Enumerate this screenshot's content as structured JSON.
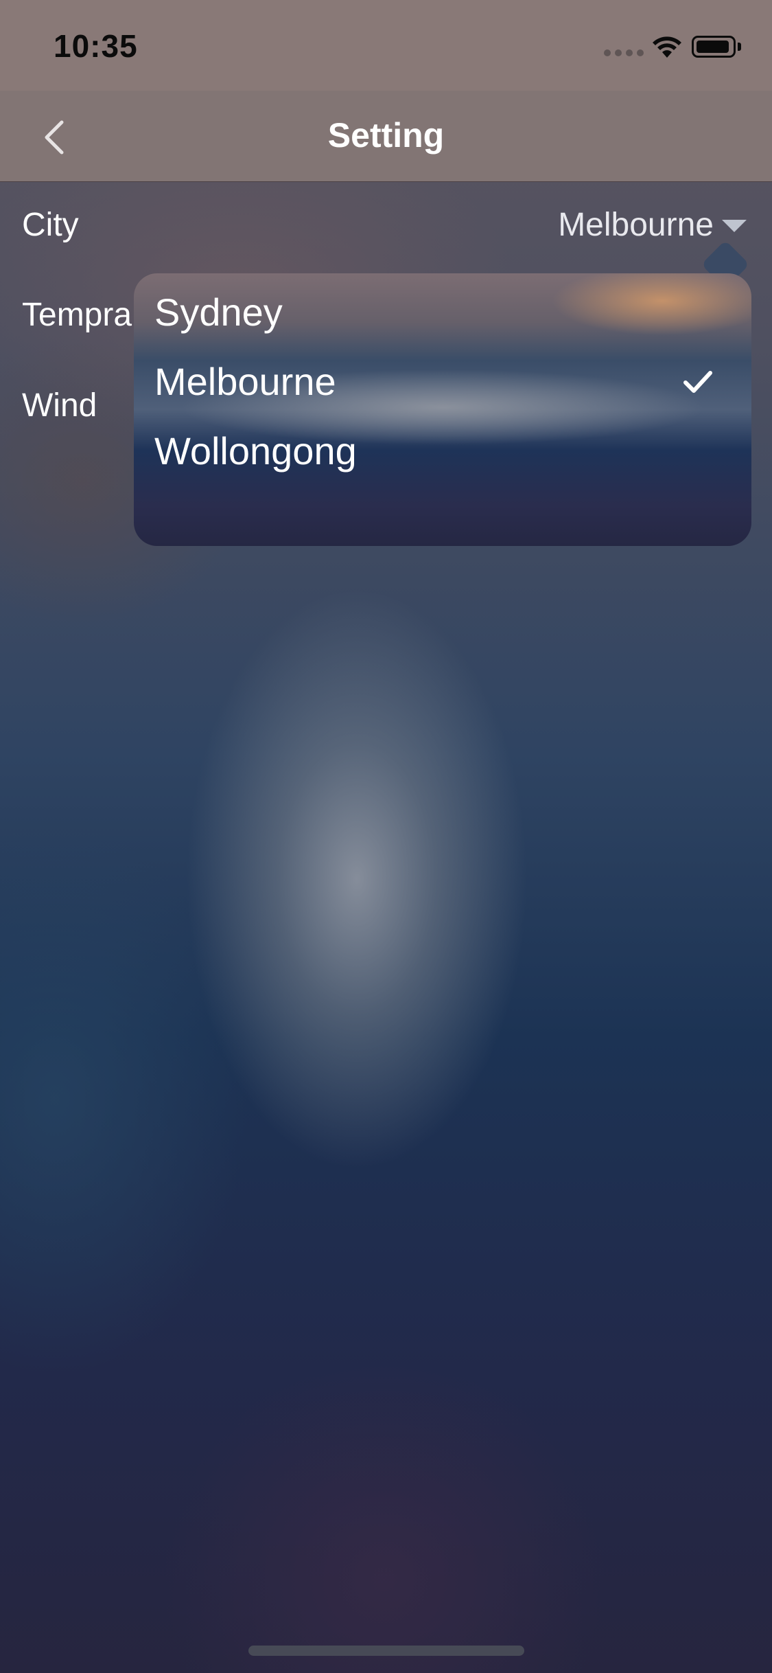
{
  "status_bar": {
    "time": "10:35",
    "signal_icon": "cellular-signal-icon",
    "wifi_icon": "wifi-icon",
    "battery_icon": "battery-icon"
  },
  "navbar": {
    "title": "Setting",
    "back_icon": "chevron-left-icon"
  },
  "settings": {
    "rows": [
      {
        "label": "City",
        "value": "Melbourne"
      },
      {
        "label": "Tempra"
      },
      {
        "label": "Wind"
      }
    ]
  },
  "city_dropdown": {
    "caret_icon": "caret-down-icon",
    "selected": "Melbourne",
    "options": [
      "Sydney",
      "Melbourne",
      "Wollongong"
    ],
    "check_icon": "checkmark-icon"
  }
}
